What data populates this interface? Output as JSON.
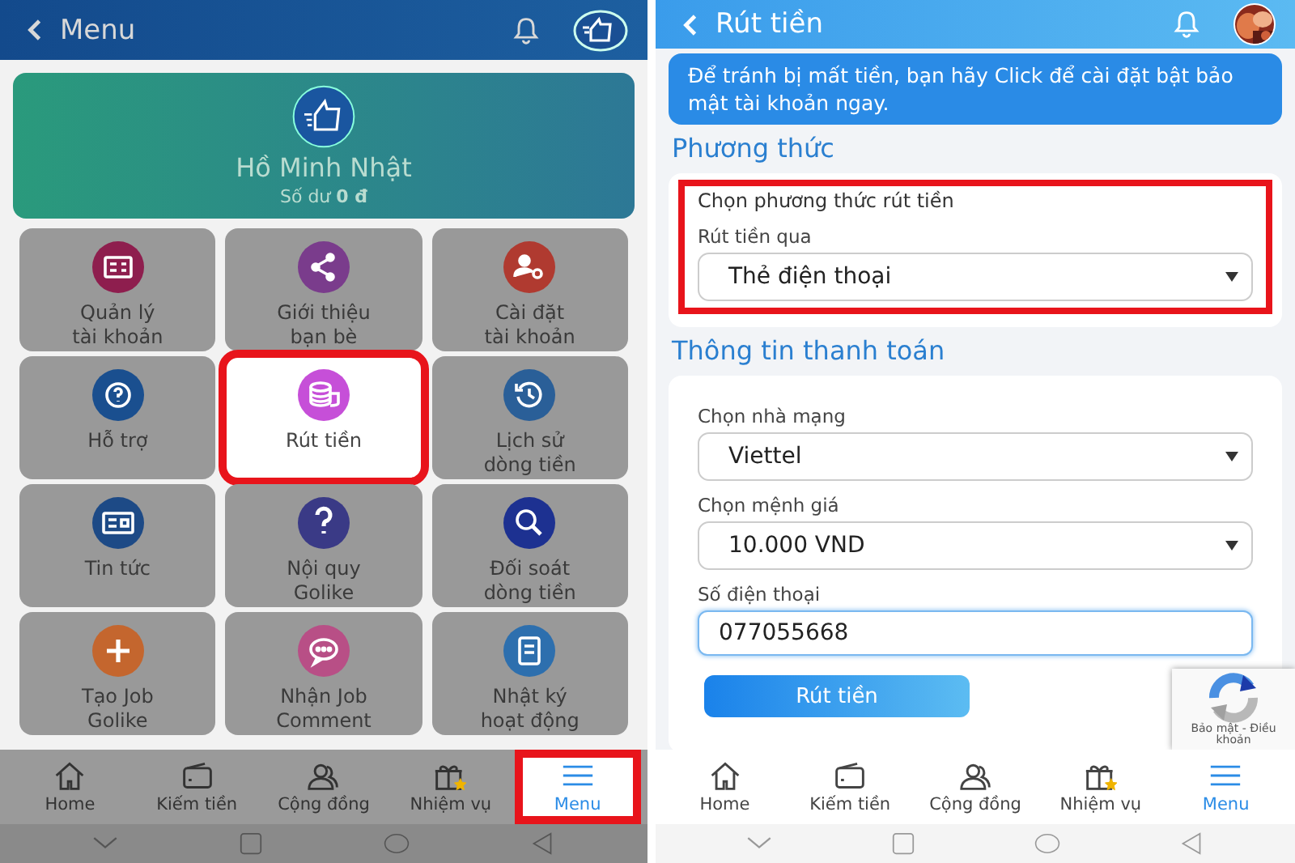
{
  "menu_screen": {
    "title": "Menu",
    "dimmed": true,
    "profile": {
      "name": "Hồ Minh Nhật",
      "balance": "Số dư **0 đ**"
    },
    "tiles": [
      {
        "label": "Quản lý\ntài khoản",
        "kind": "id-card",
        "color": "#8e1e4e",
        "highlighted": false
      },
      {
        "label": "Giới thiệu\nbạn bè",
        "kind": "share",
        "color": "#7a3c8c",
        "highlighted": false
      },
      {
        "label": "Cài đặt\ntài khoản",
        "kind": "user-gear",
        "color": "#b03a30",
        "highlighted": false
      },
      {
        "label": "Hỗ trợ",
        "kind": "help",
        "color": "#1a4f8f",
        "highlighted": false
      },
      {
        "label": "Rút tiền",
        "kind": "coins",
        "color": "#c64fd8",
        "highlighted": true
      },
      {
        "label": "Lịch sử\ndòng tiền",
        "kind": "history",
        "color": "#2a5f98",
        "highlighted": false
      },
      {
        "label": "Tin tức",
        "kind": "news",
        "color": "#1d4a86",
        "highlighted": false
      },
      {
        "label": "Nội quy\nGolike",
        "kind": "question",
        "color": "#3a3a86",
        "highlighted": false
      },
      {
        "label": "Đối soát\ndòng tiền",
        "kind": "search",
        "color": "#1d3191",
        "highlighted": false
      },
      {
        "label": "Tạo Job\nGolike",
        "kind": "plus",
        "color": "#c4662e",
        "highlighted": false
      },
      {
        "label": "Nhận Job\nComment",
        "kind": "chat",
        "color": "#b84f86",
        "highlighted": false
      },
      {
        "label": "Nhật ký\nhoạt động",
        "kind": "notebook",
        "color": "#2d6fae",
        "highlighted": false
      }
    ],
    "nav": [
      {
        "label": "Home",
        "kind": "home",
        "selected": false,
        "highlighted": false
      },
      {
        "label": "Kiếm tiền",
        "kind": "wallet",
        "selected": false,
        "highlighted": false
      },
      {
        "label": "Cộng đồng",
        "kind": "people",
        "selected": false,
        "highlighted": false
      },
      {
        "label": "Nhiệm vụ",
        "kind": "gift",
        "selected": false,
        "highlighted": false
      },
      {
        "label": "Menu",
        "kind": "menu",
        "selected": true,
        "highlighted": true
      }
    ]
  },
  "withdraw_screen": {
    "title": "Rút tiền",
    "notice": "Để tránh bị mất tiền, bạn hãy Click để cài đặt bật bảo mật tài khoản ngay.",
    "sections": [
      {
        "heading": "Phương thức",
        "highlighted": true,
        "subtitle": "Chọn phương thức rút tiền",
        "fields": [
          {
            "kind": "select",
            "label": "Rút tiền qua",
            "value": "Thẻ điện thoại",
            "focused": false
          }
        ]
      },
      {
        "heading": "Thông tin thanh toán",
        "highlighted": false,
        "fields": [
          {
            "kind": "select",
            "label": "Chọn nhà mạng",
            "value": "Viettel",
            "focused": false
          },
          {
            "kind": "select",
            "label": "Chọn mệnh giá",
            "value": "10.000 VND",
            "focused": false
          },
          {
            "kind": "input",
            "label": "Số điện thoại",
            "value": "077055668",
            "focused": true
          }
        ],
        "button": "Rút tiền"
      }
    ],
    "recaptcha": "Bảo mật - Điều khoản",
    "nav": [
      {
        "label": "Home",
        "kind": "home",
        "selected": false,
        "highlighted": false
      },
      {
        "label": "Kiếm tiền",
        "kind": "wallet",
        "selected": false,
        "highlighted": false
      },
      {
        "label": "Cộng đồng",
        "kind": "people",
        "selected": false,
        "highlighted": false
      },
      {
        "label": "Nhiệm vụ",
        "kind": "gift",
        "selected": false,
        "highlighted": false
      },
      {
        "label": "Menu",
        "kind": "menu",
        "selected": true,
        "highlighted": false
      }
    ]
  }
}
